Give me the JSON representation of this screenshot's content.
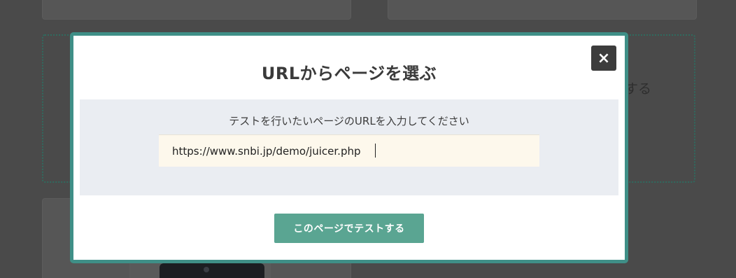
{
  "background": {
    "partial_text": "する"
  },
  "modal": {
    "title": "URLからページを選ぶ",
    "close_label": "×",
    "input_label": "テストを行いたいページのURLを入力してください",
    "url_value": "https://www.snbi.jp/demo/juicer.php",
    "submit_label": "このページでテストする"
  },
  "colors": {
    "modal_border": "#3f8f87",
    "submit_button": "#5aa592",
    "input_background": "#fdf8ec",
    "panel_background": "#eaedf2",
    "overlay": "#4a4a4a"
  }
}
